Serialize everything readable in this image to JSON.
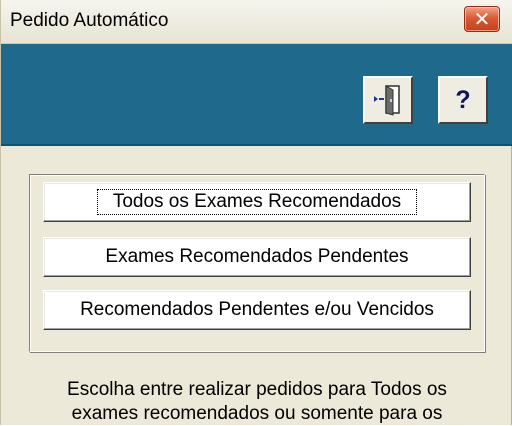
{
  "window": {
    "title": "Pedido Automático",
    "close_glyph": "✕"
  },
  "toolbar": {
    "exit_icon": "exit-door-icon",
    "help_icon": "help-icon",
    "help_glyph": "?",
    "background": "#1f6a8c"
  },
  "options": {
    "all_label": "Todos os Exames Recomendados",
    "pending_label": "Exames Recomendados Pendentes",
    "pending_expired_label": "Recomendados Pendentes e/ou Vencidos"
  },
  "info": {
    "line1": "Escolha entre realizar pedidos para Todos os",
    "line2": "exames recomendados ou somente para os"
  }
}
